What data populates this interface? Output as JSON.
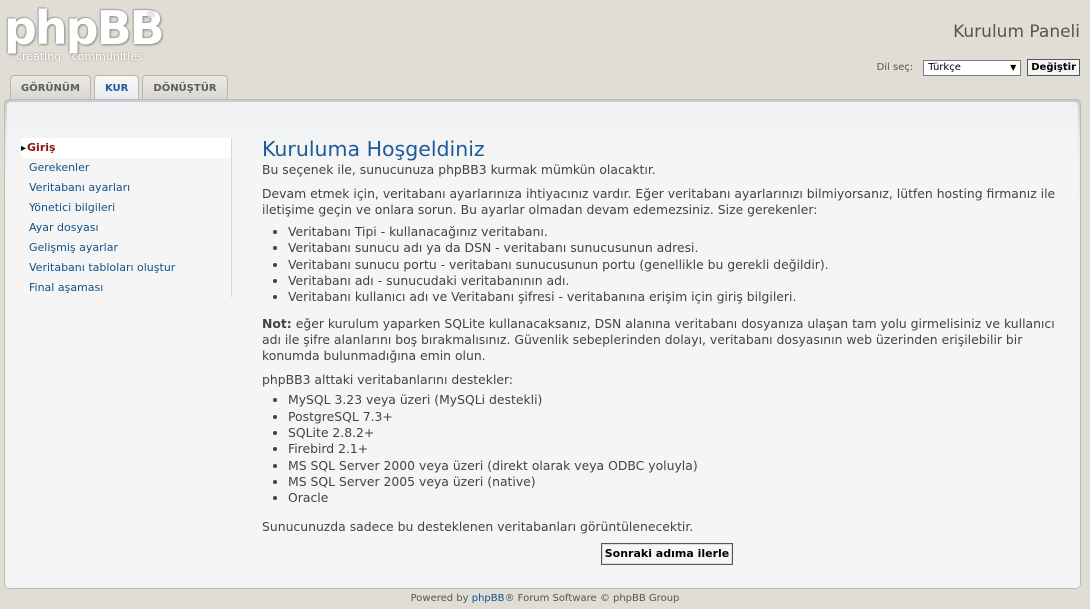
{
  "header": {
    "logo_main": "phpBB",
    "logo_reg": "®",
    "logo_sub": "creating   communities",
    "panel_title": "Kurulum Paneli",
    "lang_label": "Dil seç:",
    "lang_selected": "Türkçe",
    "lang_button": "Değiştir"
  },
  "tabs": [
    {
      "label": "GÖRÜNÜM",
      "active": false
    },
    {
      "label": "KUR",
      "active": true
    },
    {
      "label": "DÖNÜŞTÜR",
      "active": false
    }
  ],
  "sidebar": {
    "items": [
      {
        "label": "Giriş",
        "active": true
      },
      {
        "label": "Gerekenler"
      },
      {
        "label": "Veritabanı ayarları"
      },
      {
        "label": "Yönetici bilgileri"
      },
      {
        "label": "Ayar dosyası"
      },
      {
        "label": "Gelişmiş ayarlar"
      },
      {
        "label": "Veritabanı tabloları oluştur"
      },
      {
        "label": "Final aşaması"
      }
    ]
  },
  "main": {
    "title": "Kuruluma Hoşgeldiniz",
    "intro": "Bu seçenek ile, sunucunuza phpBB3 kurmak mümkün olacaktır.",
    "para1": "Devam etmek için, veritabanı ayarlarınıza ihtiyacınız vardır. Eğer veritabanı ayarlarınızı bilmiyorsanız, lütfen hosting firmanız ile iletişime geçin ve onlara sorun. Bu ayarlar olmadan devam edemezsiniz. Size gerekenler:",
    "requirements": [
      "Veritabanı Tipi - kullanacağınız veritabanı.",
      "Veritabanı sunucu adı ya da DSN - veritabanı sunucusunun adresi.",
      "Veritabanı sunucu portu - veritabanı sunucusunun portu (genellikle bu gerekli değildir).",
      "Veritabanı adı - sunucudaki veritabanının adı.",
      "Veritabanı kullanıcı adı ve Veritabanı şifresi - veritabanına erişim için giriş bilgileri."
    ],
    "note_label": "Not:",
    "note_text": " eğer kurulum yaparken SQLite kullanacaksanız, DSN alanına veritabanı dosyanıza ulaşan tam yolu girmelisiniz ve kullanıcı adı ile şifre alanlarını boş bırakmalısınız. Güvenlik sebeplerinden dolayı, veritabanı dosyasının web üzerinden erişilebilir bir konumda bulunmadığına emin olun.",
    "supported_intro": "phpBB3 alttaki veritabanlarını destekler:",
    "databases": [
      "MySQL 3.23 veya üzeri (MySQLi destekli)",
      "PostgreSQL 7.3+",
      "SQLite 2.8.2+",
      "Firebird 2.1+",
      "MS SQL Server 2000 veya üzeri (direkt olarak veya ODBC yoluyla)",
      "MS SQL Server 2005 veya üzeri (native)",
      "Oracle"
    ],
    "closing": "Sunucunuzda sadece bu desteklenen veritabanları görüntülenecektir.",
    "next_button": "Sonraki adıma ilerle"
  },
  "footer": {
    "prefix": "Powered by ",
    "brand": "phpBB",
    "suffix": "® Forum Software © phpBB Group"
  }
}
